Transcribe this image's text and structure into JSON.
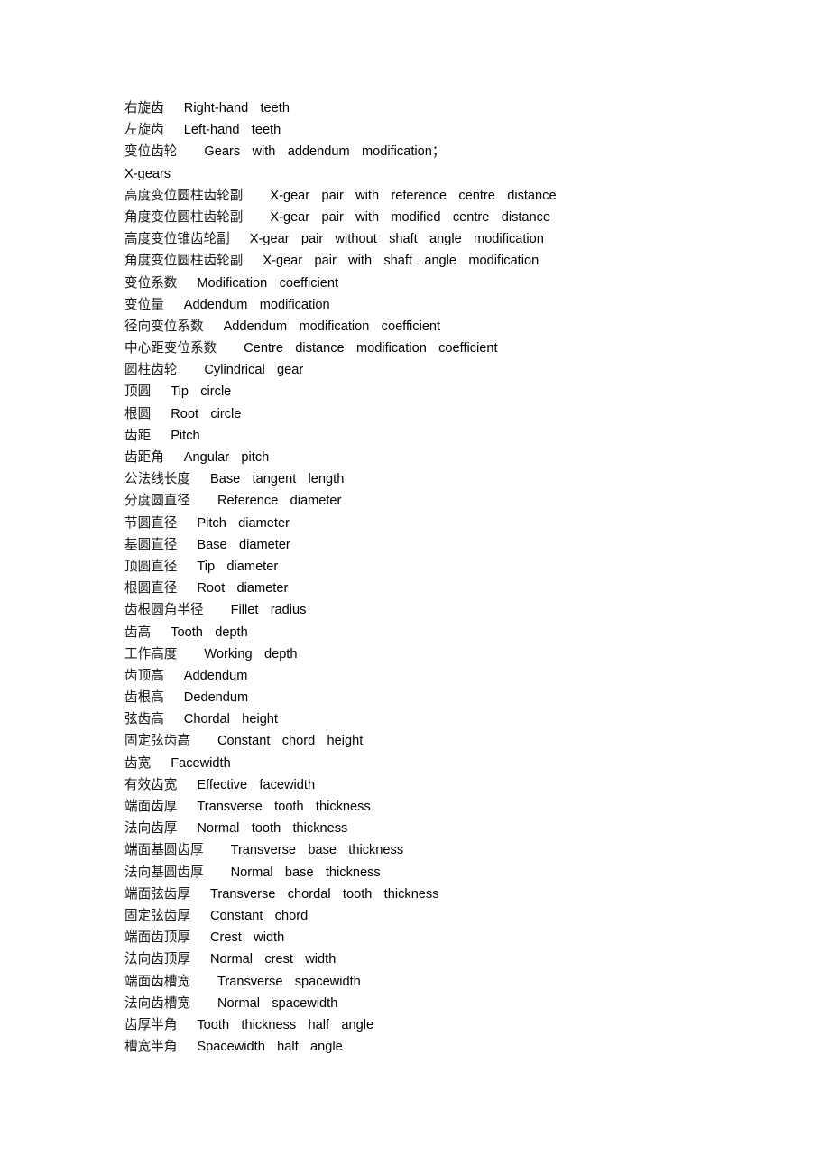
{
  "document": {
    "type": "bilingual-glossary",
    "subject": "Gear terminology (Chinese-English)",
    "background_color": "#ffffff",
    "text_color": "#000000"
  },
  "entries": [
    {
      "cn": "右旋齿",
      "en": "Right-hand  teeth",
      "gap": "gap-2"
    },
    {
      "cn": "左旋齿",
      "en": "Left-hand  teeth",
      "gap": "gap-2"
    },
    {
      "cn": "变位齿轮",
      "en": "Gears  with  addendum  modification；",
      "gap": "gap-3"
    },
    {
      "cn": "",
      "en": "X-gears",
      "gap": "gap-0",
      "continuation": true
    },
    {
      "cn": "高度变位圆柱齿轮副",
      "en": "X-gear  pair  with  reference  centre  distance",
      "gap": "gap-3"
    },
    {
      "cn": "角度变位圆柱齿轮副",
      "en": "X-gear  pair  with  modified  centre  distance",
      "gap": "gap-3"
    },
    {
      "cn": "高度变位锥齿轮副",
      "en": "X-gear  pair  without  shaft  angle  modification",
      "gap": "gap-2"
    },
    {
      "cn": "角度变位圆柱齿轮副",
      "en": "X-gear  pair  with  shaft  angle  modification",
      "gap": "gap-2"
    },
    {
      "cn": "变位系数",
      "en": "Modification  coefficient",
      "gap": "gap-2"
    },
    {
      "cn": "变位量",
      "en": "Addendum  modification",
      "gap": "gap-2"
    },
    {
      "cn": "径向变位系数",
      "en": "Addendum  modification  coefficient",
      "gap": "gap-2"
    },
    {
      "cn": "中心距变位系数",
      "en": "Centre  distance  modification  coefficient",
      "gap": "gap-3"
    },
    {
      "cn": "圆柱齿轮",
      "en": "Cylindrical  gear",
      "gap": "gap-3"
    },
    {
      "cn": "顶圆",
      "en": "Tip  circle",
      "gap": "gap-2"
    },
    {
      "cn": "根圆",
      "en": "Root  circle",
      "gap": "gap-2"
    },
    {
      "cn": "齿距",
      "en": "Pitch",
      "gap": "gap-2"
    },
    {
      "cn": "齿距角",
      "en": "Angular  pitch",
      "gap": "gap-2"
    },
    {
      "cn": "公法线长度",
      "en": "Base  tangent  length",
      "gap": "gap-2"
    },
    {
      "cn": "分度圆直径",
      "en": "Reference  diameter",
      "gap": "gap-3"
    },
    {
      "cn": "节圆直径",
      "en": "Pitch  diameter",
      "gap": "gap-2"
    },
    {
      "cn": "基圆直径",
      "en": "Base  diameter",
      "gap": "gap-2"
    },
    {
      "cn": "顶圆直径",
      "en": "Tip  diameter",
      "gap": "gap-2"
    },
    {
      "cn": "根圆直径",
      "en": "Root  diameter",
      "gap": "gap-2"
    },
    {
      "cn": "齿根圆角半径",
      "en": "Fillet  radius",
      "gap": "gap-3"
    },
    {
      "cn": "齿高",
      "en": "Tooth  depth",
      "gap": "gap-2"
    },
    {
      "cn": "工作高度",
      "en": "Working  depth",
      "gap": "gap-3"
    },
    {
      "cn": "齿顶高",
      "en": "Addendum",
      "gap": "gap-2"
    },
    {
      "cn": "齿根高",
      "en": "Dedendum",
      "gap": "gap-2"
    },
    {
      "cn": "弦齿高",
      "en": "Chordal  height",
      "gap": "gap-2"
    },
    {
      "cn": "固定弦齿高",
      "en": "Constant  chord  height",
      "gap": "gap-3"
    },
    {
      "cn": "齿宽",
      "en": "Facewidth",
      "gap": "gap-2"
    },
    {
      "cn": "有效齿宽",
      "en": "Effective  facewidth",
      "gap": "gap-2"
    },
    {
      "cn": "端面齿厚",
      "en": "Transverse  tooth  thickness",
      "gap": "gap-2"
    },
    {
      "cn": "法向齿厚",
      "en": "Normal  tooth  thickness",
      "gap": "gap-2"
    },
    {
      "cn": "端面基圆齿厚",
      "en": "Transverse  base  thickness",
      "gap": "gap-3"
    },
    {
      "cn": "法向基圆齿厚",
      "en": "Normal  base  thickness",
      "gap": "gap-3"
    },
    {
      "cn": "端面弦齿厚",
      "en": "Transverse  chordal  tooth  thickness",
      "gap": "gap-2"
    },
    {
      "cn": "固定弦齿厚",
      "en": "Constant  chord",
      "gap": "gap-2"
    },
    {
      "cn": "端面齿顶厚",
      "en": "Crest  width",
      "gap": "gap-2"
    },
    {
      "cn": "法向齿顶厚",
      "en": "Normal  crest  width",
      "gap": "gap-2"
    },
    {
      "cn": "端面齿槽宽",
      "en": "Transverse  spacewidth",
      "gap": "gap-3"
    },
    {
      "cn": "法向齿槽宽",
      "en": "Normal  spacewidth",
      "gap": "gap-3"
    },
    {
      "cn": "齿厚半角",
      "en": "Tooth  thickness  half  angle",
      "gap": "gap-2"
    },
    {
      "cn": "槽宽半角",
      "en": "Spacewidth  half  angle",
      "gap": "gap-2"
    }
  ]
}
